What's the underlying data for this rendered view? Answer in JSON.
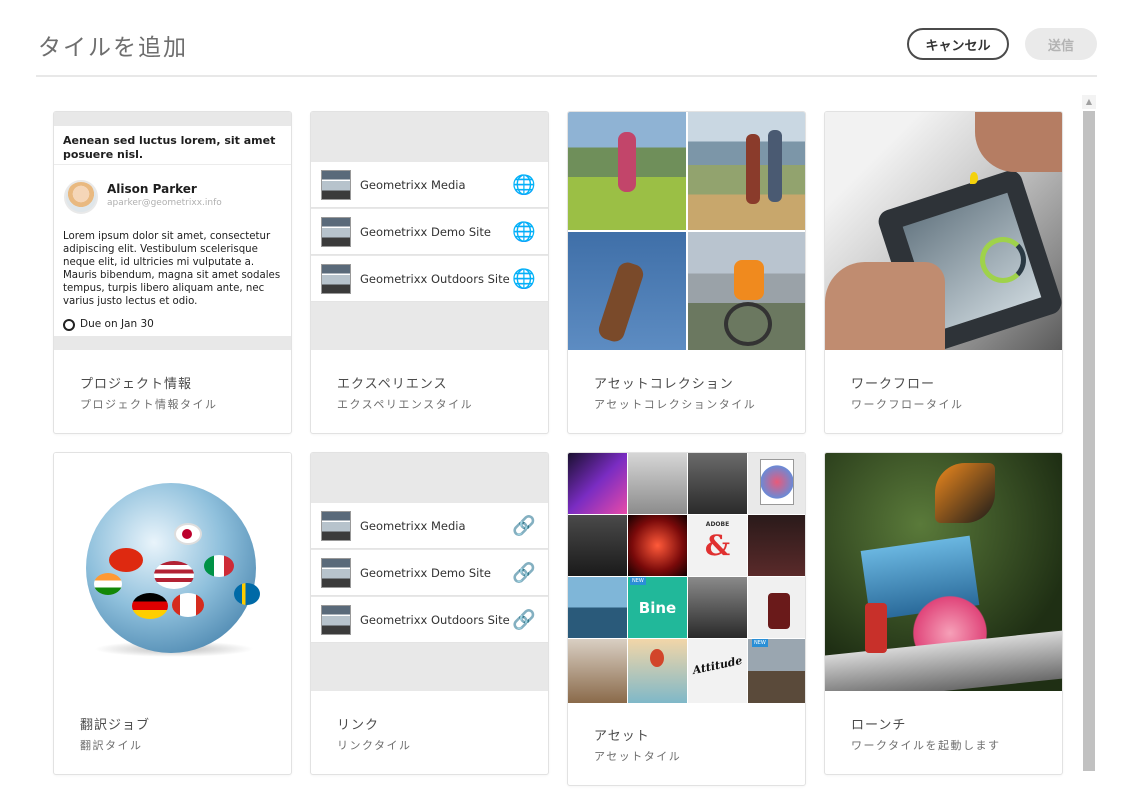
{
  "header": {
    "title": "タイルを追加",
    "cancel_label": "キャンセル",
    "send_label": "送信"
  },
  "tiles": [
    {
      "title": "プロジェクト情報",
      "subtitle": "プロジェクト情報タイル",
      "preview": {
        "heading": "Aenean sed luctus lorem, sit amet posuere nisl.",
        "user_name": "Alison Parker",
        "user_email": "aparker@geometrixx.info",
        "body": "Lorem ipsum dolor sit amet, consectetur adipiscing elit. Vestibulum scelerisque neque elit, id ultricies mi vulputate a. Mauris bibendum, magna sit amet sodales tempus, turpis libero aliquam ante, nec varius justo lectus et odio.",
        "due": "Due on Jan 30"
      }
    },
    {
      "title": "エクスペリエンス",
      "subtitle": "エクスペリエンスタイル",
      "sites": [
        "Geometrixx Media",
        "Geometrixx Demo Site",
        "Geometrixx Outdoors Site"
      ],
      "site_icon": "globe-icon"
    },
    {
      "title": "アセットコレクション",
      "subtitle": "アセットコレクションタイル"
    },
    {
      "title": "ワークフロー",
      "subtitle": "ワークフロータイル"
    },
    {
      "title": "翻訳ジョブ",
      "subtitle": "翻訳タイル"
    },
    {
      "title": "リンク",
      "subtitle": "リンクタイル",
      "sites": [
        "Geometrixx Media",
        "Geometrixx Demo Site",
        "Geometrixx Outdoors Site"
      ],
      "site_icon": "link-icon"
    },
    {
      "title": "アセット",
      "subtitle": "アセットタイル",
      "badges": [
        "NEW",
        "NEW"
      ],
      "labels": [
        "Bine",
        "Attitude",
        "ADOBE",
        "&"
      ]
    },
    {
      "title": "ローンチ",
      "subtitle": "ワークタイルを起動します"
    }
  ]
}
